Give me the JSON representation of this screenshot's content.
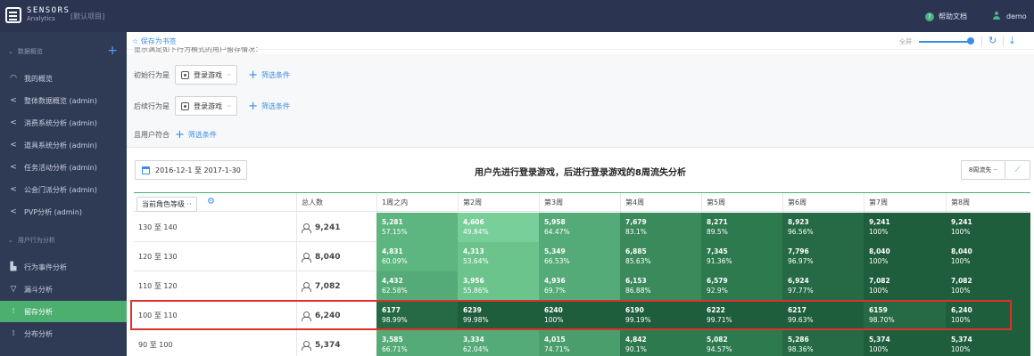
{
  "header": {
    "logo_name": "SENSORS",
    "logo_sub": "Analytics",
    "project": "[默认项目]",
    "help_label": "帮助文档",
    "help_icon": "question-icon",
    "user_name": "demo",
    "user_icon": "user-icon",
    "bg_color": "#2b3552"
  },
  "sidebar": {
    "group1": "数据概览",
    "group1_add": "+",
    "items1": [
      {
        "label": "我的概览",
        "icon": "dashboard-icon"
      },
      {
        "label": "整体数据概览 (admin)",
        "icon": "share-icon"
      },
      {
        "label": "消费系统分析 (admin)",
        "icon": "share-icon"
      },
      {
        "label": "道具系统分析 (admin)",
        "icon": "share-icon"
      },
      {
        "label": "任务活动分析 (admin)",
        "icon": "share-icon"
      },
      {
        "label": "公会门派分析 (admin)",
        "icon": "share-icon"
      },
      {
        "label": "PVP分析 (admin)",
        "icon": "share-icon"
      }
    ],
    "group2": "用户行为分析",
    "items2": [
      {
        "label": "行为事件分析",
        "icon": "bar-chart-icon"
      },
      {
        "label": "漏斗分析",
        "icon": "funnel-icon"
      },
      {
        "label": "留存分析",
        "icon": "retention-icon",
        "active": true
      },
      {
        "label": "分布分析",
        "icon": "distribution-icon"
      }
    ],
    "active_color": "#4caf6f"
  },
  "toolbar": {
    "save_label": "☆ 保存为书签",
    "description": "显示满足如下行为模式的用户留存情况：",
    "zoom_label": "全屏",
    "refresh_icon": "refresh-icon",
    "download_icon": "download-icon"
  },
  "filters": {
    "initial_label": "初始行为是",
    "initial_event": "登录游戏",
    "return_label": "后续行为是",
    "return_event": "登录游戏",
    "add_filter": "筛选条件",
    "user_label": "且用户符合",
    "user_add_filter": "筛选条件"
  },
  "report": {
    "date_range": "2016-12-1 至 2017-1-30",
    "title": "用户先进行登录游戏，后进行登录游戏的8周流失分析",
    "period_select": "8周流失 ··",
    "chart_toggle_icon": "line-chart-icon"
  },
  "table": {
    "group_select": "当前角色等级 ··",
    "columns": [
      "总人数",
      "1周之内",
      "第2周",
      "第3周",
      "第4周",
      "第5周",
      "第6周",
      "第7周",
      "第8周"
    ],
    "rows": [
      {
        "label": "130 至 140",
        "total": "9,241",
        "cells": [
          {
            "n": "5,281",
            "p": "57.15%"
          },
          {
            "n": "4,606",
            "p": "49.84%"
          },
          {
            "n": "5,958",
            "p": "64.47%"
          },
          {
            "n": "7,679",
            "p": "83.1%"
          },
          {
            "n": "8,271",
            "p": "89.5%"
          },
          {
            "n": "8,923",
            "p": "96.56%"
          },
          {
            "n": "9,241",
            "p": "100%"
          },
          {
            "n": "9,241",
            "p": "100%"
          }
        ]
      },
      {
        "label": "120 至 130",
        "total": "8,040",
        "cells": [
          {
            "n": "4,831",
            "p": "60.09%"
          },
          {
            "n": "4,313",
            "p": "53.64%"
          },
          {
            "n": "5,349",
            "p": "66.53%"
          },
          {
            "n": "6,885",
            "p": "85.63%"
          },
          {
            "n": "7,345",
            "p": "91.36%"
          },
          {
            "n": "7,796",
            "p": "96.97%"
          },
          {
            "n": "8,040",
            "p": "100%"
          },
          {
            "n": "8,040",
            "p": "100%"
          }
        ]
      },
      {
        "label": "110 至 120",
        "total": "7,082",
        "cells": [
          {
            "n": "4,432",
            "p": "62.58%"
          },
          {
            "n": "3,956",
            "p": "55.86%"
          },
          {
            "n": "4,936",
            "p": "69.7%"
          },
          {
            "n": "6,153",
            "p": "86.88%"
          },
          {
            "n": "6,579",
            "p": "92.9%"
          },
          {
            "n": "6,924",
            "p": "97.77%"
          },
          {
            "n": "7,082",
            "p": "100%"
          },
          {
            "n": "7,082",
            "p": "100%"
          }
        ]
      },
      {
        "label": "100 至 110",
        "total": "6,240",
        "highlighted": true,
        "cells": [
          {
            "n": "6177",
            "p": "98.99%"
          },
          {
            "n": "6239",
            "p": "99.98%"
          },
          {
            "n": "6240",
            "p": "100%"
          },
          {
            "n": "6190",
            "p": "99.19%"
          },
          {
            "n": "6222",
            "p": "99.71%"
          },
          {
            "n": "6217",
            "p": "99.63%"
          },
          {
            "n": "6159",
            "p": "98.70%"
          },
          {
            "n": "6,240",
            "p": "100%"
          }
        ]
      },
      {
        "label": "90 至 100",
        "total": "5,374",
        "cells": [
          {
            "n": "3,585",
            "p": "66.71%"
          },
          {
            "n": "3,334",
            "p": "62.04%"
          },
          {
            "n": "4,015",
            "p": "74.71%"
          },
          {
            "n": "4,842",
            "p": "90.1%"
          },
          {
            "n": "5,082",
            "p": "94.57%"
          },
          {
            "n": "5,286",
            "p": "98.36%"
          },
          {
            "n": "5,374",
            "p": "100%"
          },
          {
            "n": "5,374",
            "p": "100%"
          }
        ]
      }
    ],
    "highlight_color": "#e0302a"
  }
}
